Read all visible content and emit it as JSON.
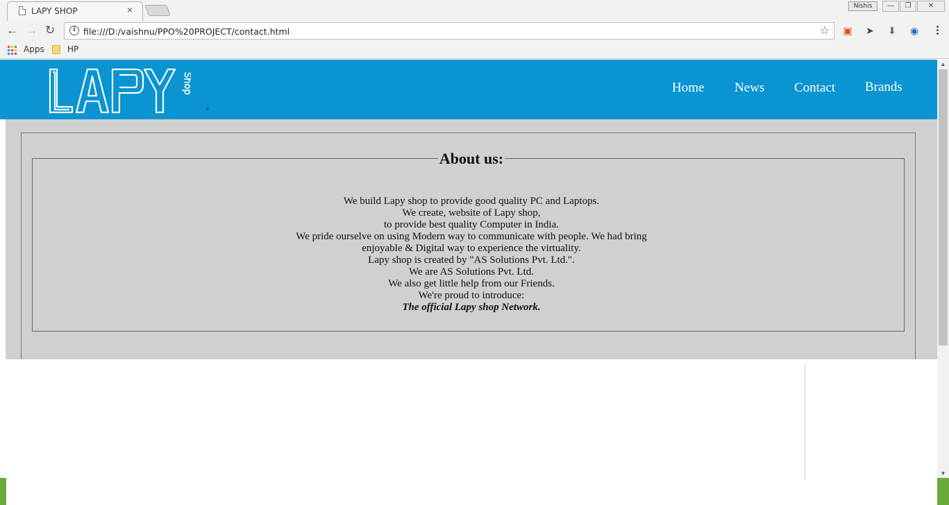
{
  "browser": {
    "tab_title": "LAPY SHOP",
    "tab_close": "×",
    "user_badge": "Nishis",
    "url": "file:///D:/vaishnu/PPO%20PROJECT/contact.html",
    "bookmarks": [
      {
        "label": "Apps",
        "icon": "apps-grid-icon"
      },
      {
        "label": "HP",
        "icon": "folder-icon"
      }
    ],
    "extensions": [
      "office-icon",
      "rocket-icon",
      "download-icon",
      "globe-icon"
    ]
  },
  "site": {
    "logo_text": "LAPY",
    "logo_subtext": "Shop",
    "nav": [
      {
        "label": "Home"
      },
      {
        "label": "News"
      },
      {
        "label": "Contact"
      },
      {
        "label": "Brands"
      }
    ],
    "colors": {
      "header": "#0a94d1",
      "content_bg": "#d0d0d0",
      "nav_text": "#ffffff"
    }
  },
  "about": {
    "title": "About us:",
    "lines": [
      "We build Lapy shop to provide good quality PC and Laptops.",
      "We create, website of Lapy shop,",
      "to provide best quality Computer in India.",
      "We pride ourselve on using Modern way to communicate with people. We had bring",
      "enjoyable & Digital way to experience the virtuality.",
      "Lapy shop is created by \"AS Solutions Pvt. Ltd.\".",
      "We are AS Solutions Pvt. Ltd.",
      "We also get little help from our Friends.",
      "We're proud to introduce:"
    ],
    "closing": "The official Lapy shop Network."
  }
}
